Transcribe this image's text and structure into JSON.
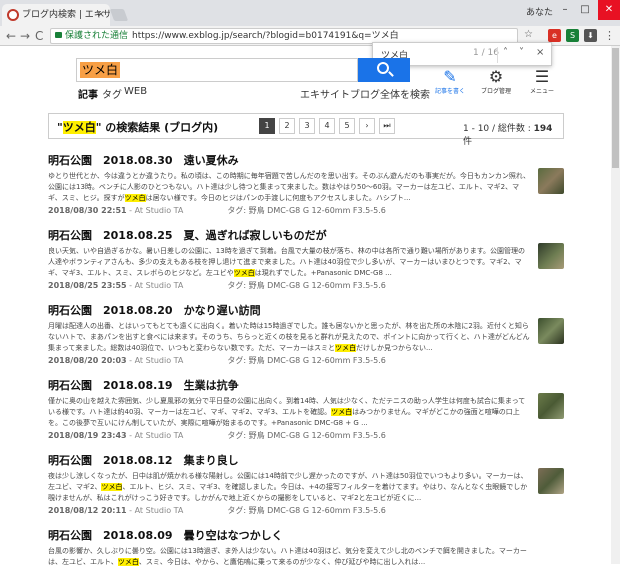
{
  "browser": {
    "tab_title": "ブログ内検索 | エキサイトブロ",
    "tab_close": "×",
    "user": "あなた",
    "win_min": "–",
    "win_max": "□",
    "win_close": "✕",
    "back": "←",
    "forward": "→",
    "reload": "C",
    "secure_label": "保護された通信",
    "url": "https://www.exblog.jp/search/?blogid=b0174191&q=ツメ白",
    "bookmark_star": "☆",
    "menu": "⋮",
    "ext_labels": [
      "e",
      "S",
      "⬇"
    ]
  },
  "findbar": {
    "query": "ツメ白",
    "count": "1 / 16",
    "prev": "˄",
    "next": "˅",
    "close": "×"
  },
  "search": {
    "term": "ツメ白",
    "scopes": [
      "記事",
      "タグ",
      "WEB"
    ],
    "global": "エキサイトブログ全体を検索"
  },
  "tools": {
    "write_icon": "✎",
    "write": "記事を書く",
    "manage_icon": "⚙",
    "manage": "ブログ管理",
    "menu_icon": "☰",
    "menu": "メニュー"
  },
  "results_header": {
    "open_quote": "\"",
    "term": "ツメ白",
    "rest": "\" の検索結果 (ブログ内)",
    "pages": [
      "1",
      "2",
      "3",
      "4",
      "5",
      "›",
      "⏭"
    ],
    "count_prefix": "1 - 10 / 総件数 : ",
    "count": "194",
    "count_suffix": " 件"
  },
  "colors": {
    "accent": "#1a73e8",
    "highlight": "#ffef00",
    "term_highlight": "#f79f45"
  },
  "entries": [
    {
      "title": "明石公園　2018.08.30　遠い夏休み",
      "ex1": "ゆとり世代とか、今は違うとか違うたり。私の頃は、この時期に毎年宿題で苦しんだのを思い出す。そのぶん遊んだのも事実だが。今日もカンカン照れ、公園には13時。ベンチに人影のひとつもない。ハト達は少し待つと集まって来ました。数はやはり50〜60羽。マーカーは左ユビ、エルト、マギ2、マギ、スミ、ヒジ。探すが",
      "hl": "ツメ白",
      "ex2": "は居ない様です。今日のヒジはパンの手渡しに何度もアクセスしました。ハシブト...",
      "date": "2018/08/30 22:51",
      "studio": " - At Studio TA",
      "tags": "タグ: 野鳥 DMC-G8 G 12-60mm F3.5-5.6"
    },
    {
      "title": "明石公園　2018.08.25　夏、過ぎれば寂しいものだが",
      "ex1": "良い天気、いや自過ぎるかな。暑い日差しの公園に、13時を過ぎて到着。台風で大量の枝が落ち、林の中は各所で通り難い場所があります。公園管理の人達やボランティアさんも、多少の支えもある枝を押し退けて進まで来ました。ハト達は40羽位で少し多いが、マーカーはいまひとつです。マギ2、マギ、マギ3、エルト、スミ、スレボらのヒジなど。左ユビや",
      "hl": "ツメ白",
      "ex2": "は現れずでした。+Panasonic DMC-G8 ...",
      "date": "2018/08/25 23:55",
      "studio": " - At Studio TA",
      "tags": "タグ: 野鳥 DMC-G8 G 12-60mm F3.5-5.6"
    },
    {
      "title": "明石公園　2018.08.20　かなり遅い訪問",
      "ex1": "月曜は配達人の出番、とはいってもとても遠くに出向く。着いた時は15時過ぎでした。誰も居ないかと思ったが、林を出た所の木陰に2羽。近付くと知らないハトで、まあパンを出すと食べには来ます。そのうち、ちらっと近くの枝を見ると群れが見えたので、ポイントに向かって行くと、ハト達がどんどん集まって来ました。総数は40羽位で、いつもと変わらない数です。ただ、マーカーはスミと",
      "hl": "ツメ白",
      "ex2": "だけしか見つからない...",
      "date": "2018/08/20 20:03",
      "studio": " - At Studio TA",
      "tags": "タグ: 野鳥 DMC-G8 G 12-60mm F3.5-5.6"
    },
    {
      "title": "明石公園　2018.08.19　生業は抗争",
      "ex1": "僅かに奥の山を越えた雰囲気、少し夏風邪の気分で平日昼の公園に出向く。到着14時、人気は少なく、ただテニスの助っ人学生は何度も試合に集まっている様です。ハト達は約40羽、マーカーは左ユビ、マギ、マギ2、マギ3、エルトを確認。",
      "hl": "ツメ白",
      "ex2": "はみつかりません。マギがどこかの強面と喧嘩の口上を。この後夢で互いにけん制していたが、実際に喧嘩が始まるのです。+Panasonic DMC-G8 + G ...",
      "date": "2018/08/19 23:43",
      "studio": " - At Studio TA",
      "tags": "タグ: 野鳥 DMC-G8 G 12-60mm F3.5-5.6"
    },
    {
      "title": "明石公園　2018.08.12　集まり良し",
      "ex1": "夜は少し涼しくなったが、日中は肌が焼かれる様な陽射し。公園には14時前で少し遅かったのですが、ハト達は50羽位でいつもより多い。マーカーは、左ユビ、マギ2、",
      "hl": "ツメ白",
      "ex2": "、エルト、ヒジ、スミ、マギ3、を確認しました。今日は、+4の接写フィルターを着けてます。やはり、なんとなく虫眼鏡でしか覗けませんが、私はこれがけっこう好きです。しかがんで地上近くからの撮影をしていると、マギ2と左ユビが近くに...",
      "date": "2018/08/12 20:11",
      "studio": " - At Studio TA",
      "tags": "タグ: 野鳥 DMC-G8 G 12-60mm F3.5-5.6"
    },
    {
      "title": "明石公園　2018.08.09　曇り空はなつかしく",
      "ex1": "台風の影響か、久しぶりに曇り空。公園には13時過ぎ、ま外人は少ない。ハト達は40羽ほど、気分を変えて少し北のベンチで餌を開きました。マーカーは、左ユビ、エルト、",
      "hl": "ツメ白",
      "ex2": "、スミ、今日は、やから、と鷹佑嗚に乗って来るのが少なく、仲び延びや時に出し入れは...",
      "date": "",
      "studio": "",
      "tags": ""
    }
  ]
}
